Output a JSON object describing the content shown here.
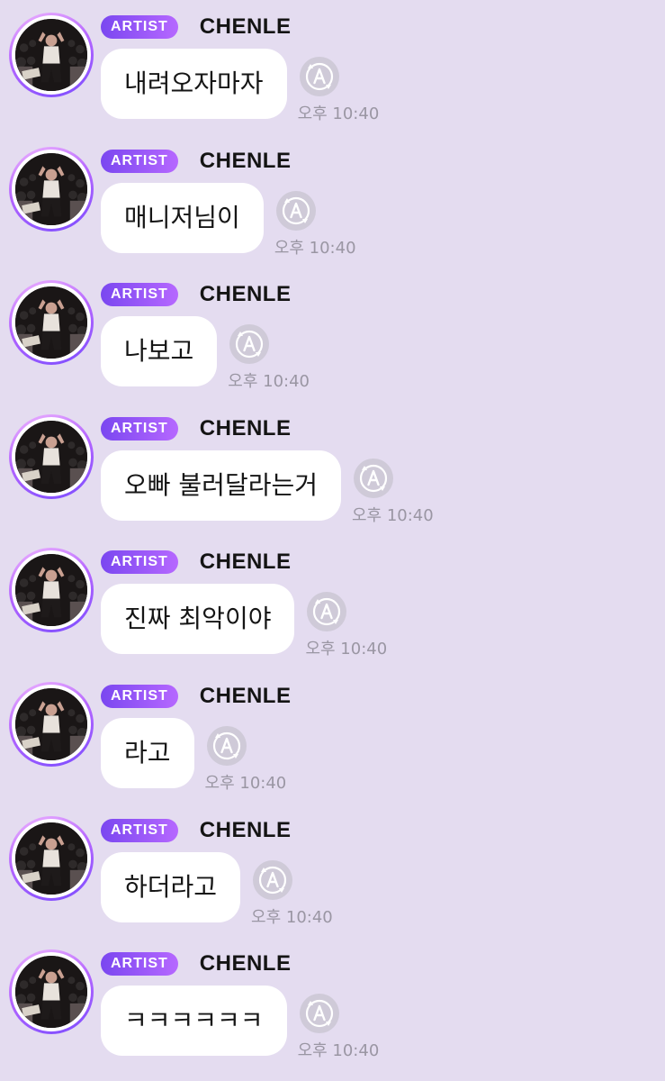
{
  "badge_label": "ARTIST",
  "sender_name": "CHENLE",
  "time_label": "오후 10:40",
  "icons": {
    "avatar": "profile-photo",
    "translate": "translate-a-icon"
  },
  "colors": {
    "background": "#e4dcf0",
    "badge_start": "#7a47f0",
    "badge_end": "#b668ff",
    "bubble": "#ffffff",
    "timestamp": "#9a96a3"
  },
  "messages": [
    {
      "text": "내려오자마자"
    },
    {
      "text": "매니저님이"
    },
    {
      "text": "나보고"
    },
    {
      "text": "오빠 불러달라는거"
    },
    {
      "text": "진짜 최악이야"
    },
    {
      "text": "라고"
    },
    {
      "text": "하더라고"
    },
    {
      "text": "ㅋㅋㅋㅋㅋㅋ"
    }
  ]
}
